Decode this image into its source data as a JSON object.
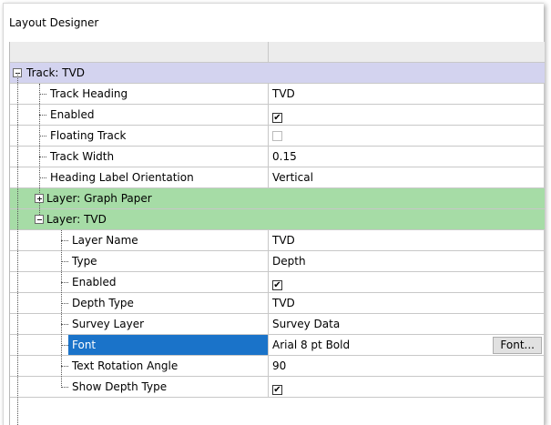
{
  "window": {
    "title": "Layout Designer"
  },
  "track": {
    "label": "Track: TVD"
  },
  "track_props": [
    {
      "name": "Track Heading",
      "value": "TVD"
    },
    {
      "name": "Enabled",
      "checked": true
    },
    {
      "name": "Floating Track",
      "checked": false
    },
    {
      "name": "Track Width",
      "value": "0.15"
    },
    {
      "name": "Heading Label Orientation",
      "value": "Vertical"
    }
  ],
  "layers": [
    {
      "label": "Layer: Graph Paper",
      "expanded": false
    },
    {
      "label": "Layer: TVD",
      "expanded": true
    }
  ],
  "layer_props": [
    {
      "name": "Layer Name",
      "value": "TVD"
    },
    {
      "name": "Type",
      "value": "Depth"
    },
    {
      "name": "Enabled",
      "checked": true
    },
    {
      "name": "Depth Type",
      "value": "TVD"
    },
    {
      "name": "Survey Layer",
      "value": "Survey Data"
    },
    {
      "name": "Font",
      "value": "Arial 8 pt Bold",
      "button": "Font...",
      "selected": true
    },
    {
      "name": "Text Rotation Angle",
      "value": "90"
    },
    {
      "name": "Show Depth Type",
      "checked": true
    }
  ],
  "colors": {
    "track_row": "#d3d3ef",
    "layer_row": "#a6dca6",
    "selection": "#1a73c9"
  }
}
